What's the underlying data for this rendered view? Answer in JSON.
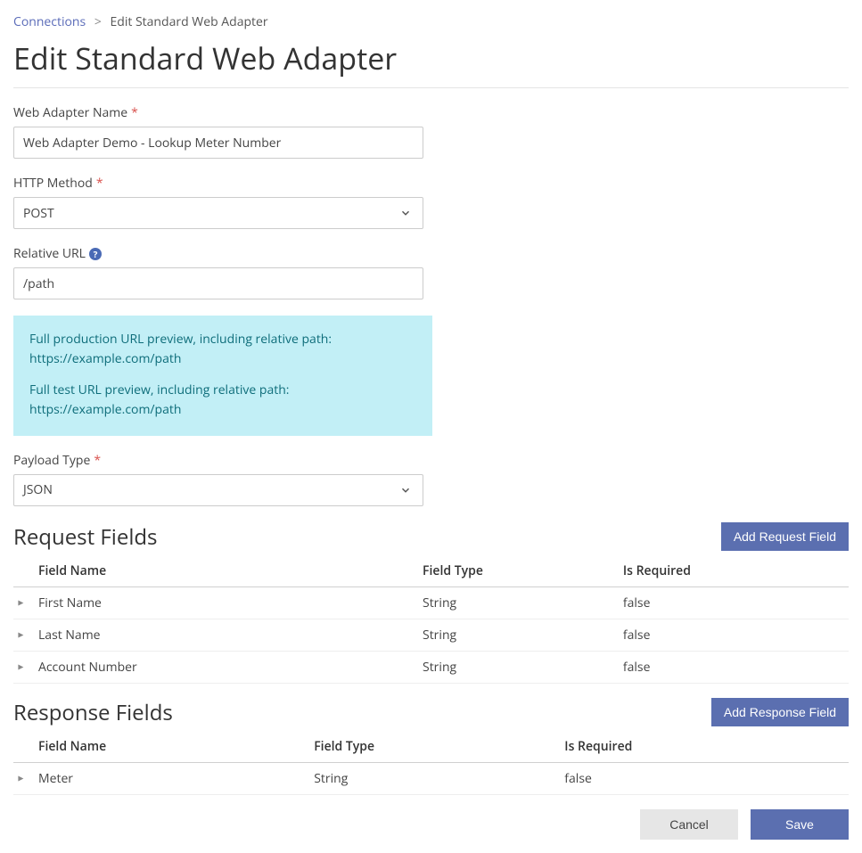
{
  "breadcrumb": {
    "parent": "Connections",
    "sep": ">",
    "current": "Edit Standard Web Adapter"
  },
  "page_title": "Edit Standard Web Adapter",
  "fields": {
    "name_label": "Web Adapter Name",
    "name_value": "Web Adapter Demo - Lookup Meter Number",
    "method_label": "HTTP Method",
    "method_value": "POST",
    "url_label": "Relative URL",
    "url_value": "/path",
    "payload_label": "Payload Type",
    "payload_value": "JSON"
  },
  "preview": {
    "line1": "Full production URL preview, including relative path:",
    "line2": "https://example.com/path",
    "line3": "Full test URL preview, including relative path:",
    "line4": "https://example.com/path"
  },
  "table_headers": {
    "col1": "Field Name",
    "col2": "Field Type",
    "col3": "Is Required"
  },
  "request": {
    "title": "Request Fields",
    "add_label": "Add Request Field",
    "rows": [
      {
        "name": "First Name",
        "type": "String",
        "required": "false"
      },
      {
        "name": "Last Name",
        "type": "String",
        "required": "false"
      },
      {
        "name": "Account Number",
        "type": "String",
        "required": "false"
      }
    ]
  },
  "response": {
    "title": "Response Fields",
    "add_label": "Add Response Field",
    "rows": [
      {
        "name": "Meter",
        "type": "String",
        "required": "false"
      }
    ]
  },
  "actions": {
    "cancel": "Cancel",
    "save": "Save"
  },
  "asterisk": "*"
}
